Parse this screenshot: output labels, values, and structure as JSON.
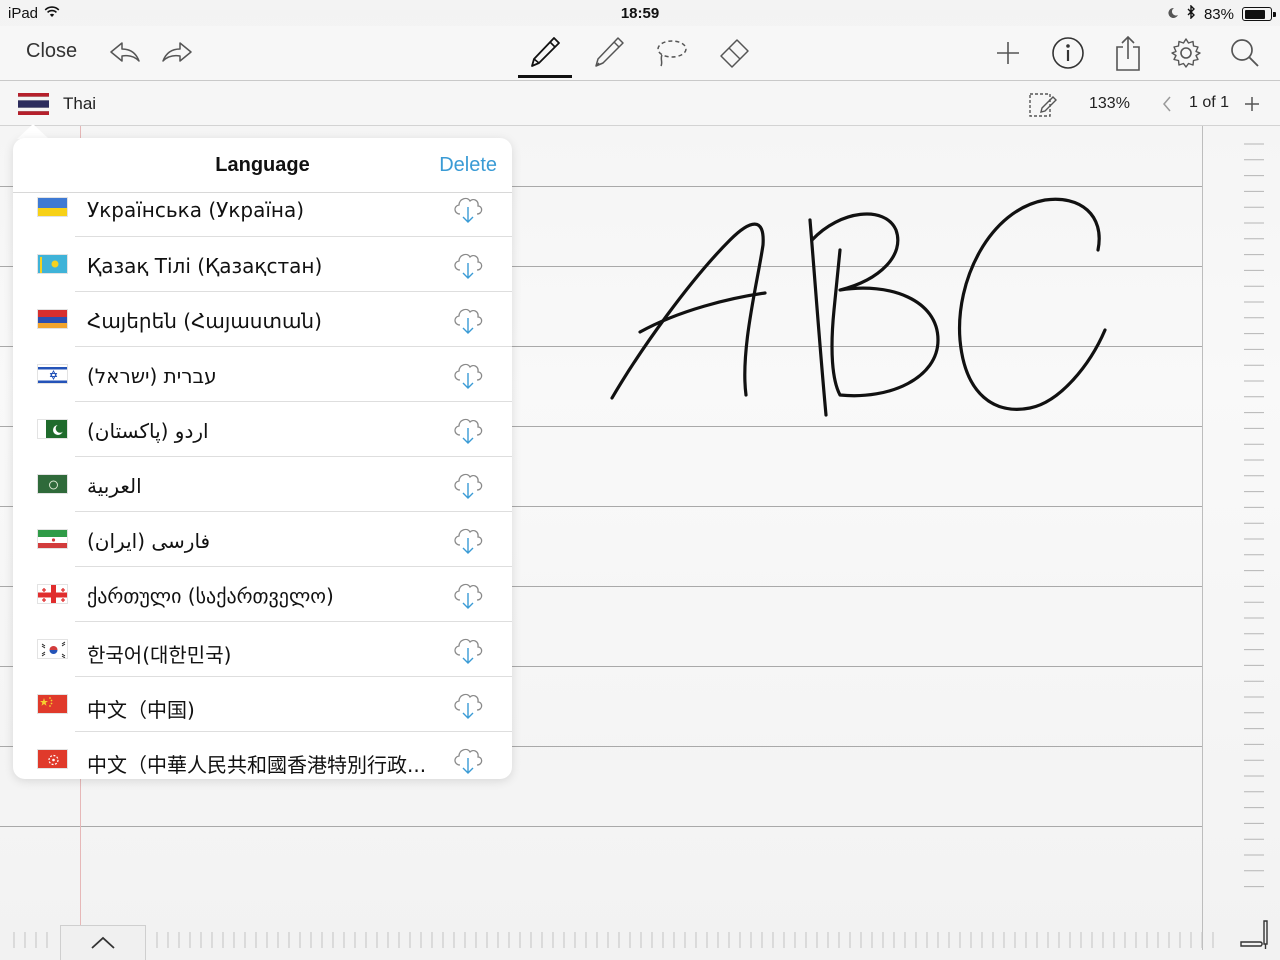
{
  "status_bar": {
    "device": "iPad",
    "time": "18:59",
    "battery": "83%",
    "battery_level": 0.83
  },
  "toolbar": {
    "close_label": "Close",
    "icons": [
      "undo-icon",
      "redo-icon",
      "pen-icon",
      "pencil-icon",
      "lasso-icon",
      "eraser-icon",
      "plus-icon",
      "info-icon",
      "share-icon",
      "gear-icon",
      "search-icon"
    ],
    "active_tool": "pen"
  },
  "language_bar": {
    "current_language": "Thai",
    "zoom": "133%",
    "page_indicator": "1 of 1"
  },
  "popover": {
    "title": "Language",
    "delete_label": "Delete",
    "items": [
      {
        "label": "Українська (Україна)",
        "flag": "ukraine"
      },
      {
        "label": "Қазақ Тілі (Қазақстан)",
        "flag": "kazakhstan"
      },
      {
        "label": "Հայերեն (Հայաստան)",
        "flag": "armenia"
      },
      {
        "label": "עברית (ישראל)",
        "flag": "israel"
      },
      {
        "label": "اردو (پاکستان)",
        "flag": "pakistan"
      },
      {
        "label": "العربية",
        "flag": "saudi-arabia"
      },
      {
        "label": "فارسی (ایران)",
        "flag": "iran"
      },
      {
        "label": "ქართული (საქართველო)",
        "flag": "georgia"
      },
      {
        "label": "한국어(대한민국)",
        "flag": "south-korea"
      },
      {
        "label": "中文（中国)",
        "flag": "china"
      },
      {
        "label": "中文（中華人民共和國香港特別行政...",
        "flag": "hong-kong"
      }
    ]
  },
  "canvas": {
    "handwriting": "ABC"
  },
  "colors": {
    "accent": "#3a9bd5",
    "ink": "#111111",
    "ruled_line": "#a9a9a9",
    "margin_line": "#e6b7b7"
  }
}
